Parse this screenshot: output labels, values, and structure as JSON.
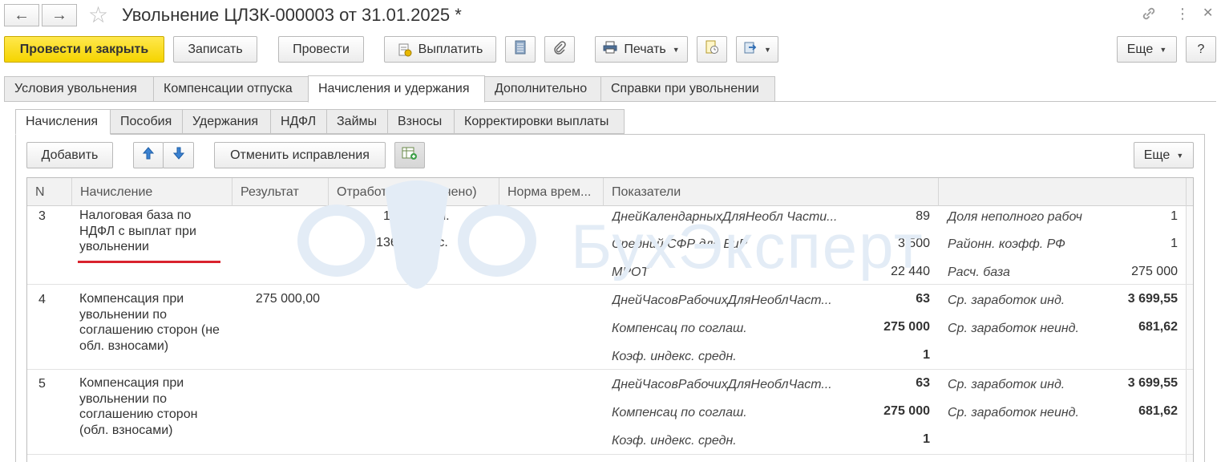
{
  "window": {
    "title": "Увольнение ЦЛЗК-000003 от 31.01.2025 *"
  },
  "icons": {
    "back": "←",
    "forward": "→",
    "star": "☆",
    "link": "🔗",
    "more": "⋮",
    "close": "✕",
    "up": "🡅",
    "down": "🡇"
  },
  "toolbar": {
    "post_close": "Провести и закрыть",
    "save": "Записать",
    "post": "Провести",
    "pay": "Выплатить",
    "print": "Печать",
    "more": "Еще",
    "help": "?"
  },
  "tabs": [
    {
      "label": "Условия увольнения"
    },
    {
      "label": "Компенсации отпуска"
    },
    {
      "label": "Начисления и удержания"
    },
    {
      "label": "Дополнительно"
    },
    {
      "label": "Справки при увольнении"
    }
  ],
  "subtabs": [
    {
      "label": "Начисления"
    },
    {
      "label": "Пособия"
    },
    {
      "label": "Удержания"
    },
    {
      "label": "НДФЛ"
    },
    {
      "label": "Займы"
    },
    {
      "label": "Взносы"
    },
    {
      "label": "Корректировки выплаты"
    }
  ],
  "grid_toolbar": {
    "add": "Добавить",
    "cancel_fix": "Отменить исправления",
    "more": "Еще"
  },
  "columns": {
    "n": "N",
    "accrual": "Начисление",
    "result": "Результат",
    "worked": "Отработано (оплачено)",
    "norm": "Норма врем...",
    "indicators": "Показатели"
  },
  "watermark": "БухЭксперт",
  "rows": [
    {
      "n": "3",
      "accrual": "Налоговая база по НДФЛ с выплат при увольнении",
      "result": "",
      "worked": [
        {
          "value": "17,00",
          "unit": "дн."
        },
        {
          "value": "136,00",
          "unit": "чс."
        }
      ],
      "indicators": [
        {
          "name": "ДнейКалендарныхДляНеобл Части...",
          "value": "89",
          "name2": "Доля неполного рабоч",
          "value2": "1"
        },
        {
          "name": "Средний СФР для БиР",
          "value": "3 500",
          "name2": "Районн. коэфф. РФ",
          "value2": "1"
        },
        {
          "name": "МРОТ",
          "value": "22 440",
          "name2": "Расч. база",
          "value2": "275 000"
        }
      ]
    },
    {
      "n": "4",
      "accrual": "Компенсация при увольнении по соглашению сторон (не обл. взносами)",
      "result": "275 000,00",
      "indicators": [
        {
          "name": "ДнейЧасовРабочихДляНеоблЧаст...",
          "value": "63",
          "name2": "Ср. заработок инд.",
          "value2": "3 699,55"
        },
        {
          "name": "Компенсац по соглаш.",
          "value": "275 000",
          "name2": "Ср. заработок неинд.",
          "value2": "681,62"
        },
        {
          "name": "Коэф. индекс. средн.",
          "value": "1",
          "name2": "",
          "value2": ""
        }
      ]
    },
    {
      "n": "5",
      "accrual": "Компенсация при увольнении по соглашению сторон (обл. взносами)",
      "result": "",
      "indicators": [
        {
          "name": "ДнейЧасовРабочихДляНеоблЧаст...",
          "value": "63",
          "name2": "Ср. заработок инд.",
          "value2": "3 699,55"
        },
        {
          "name": "Компенсац по соглаш.",
          "value": "275 000",
          "name2": "Ср. заработок неинд.",
          "value2": "681,62"
        },
        {
          "name": "Коэф. индекс. средн.",
          "value": "1",
          "name2": "",
          "value2": ""
        }
      ]
    }
  ],
  "colors": {
    "primary_button": "#f5d400",
    "underline_mark": "#d9232e",
    "watermark": "#e3ecf6"
  }
}
